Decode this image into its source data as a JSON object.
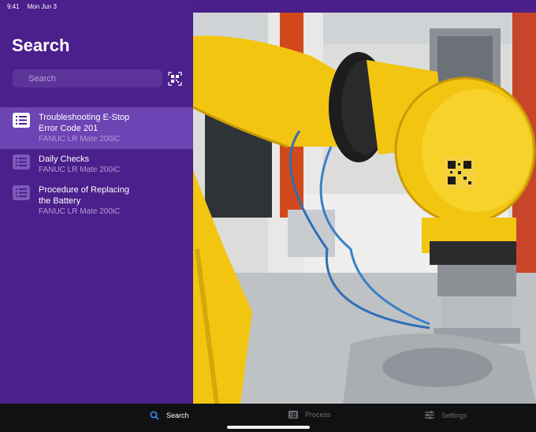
{
  "status": {
    "time": "9:41",
    "date": "Mon Jun 3"
  },
  "sidebar": {
    "title": "Search",
    "search_placeholder": "Search",
    "results": [
      {
        "title": "Troubleshooting E-Stop Error Code 201",
        "subtitle": "FANUC LR Mate 200iC",
        "selected": true
      },
      {
        "title": "Daily Checks",
        "subtitle": "FANUC LR Mate 200iC",
        "selected": false
      },
      {
        "title": "Procedure of Replacing the Battery",
        "subtitle": "FANUC LR Mate 200iC",
        "selected": false
      }
    ]
  },
  "tabs": [
    {
      "label": "Search",
      "icon": "magnifier-icon",
      "active": true
    },
    {
      "label": "Process",
      "icon": "list-icon",
      "active": false
    },
    {
      "label": "Settings",
      "icon": "sliders-icon",
      "active": false
    }
  ],
  "colors": {
    "sidebar": "#4b1f8c",
    "selected_row": "#6c44b3",
    "accent": "#3a8ef6",
    "robot_yellow": "#f2c511"
  }
}
